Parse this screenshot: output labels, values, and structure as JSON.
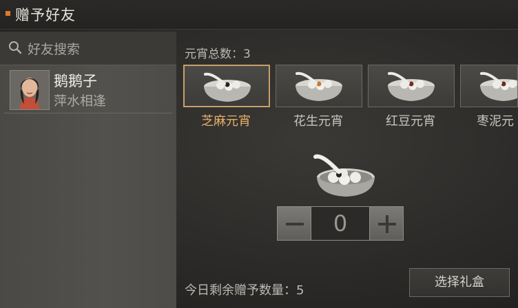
{
  "window": {
    "title": "赠予好友"
  },
  "sidebar": {
    "search_placeholder": "好友搜索",
    "friends": [
      {
        "name": "鹅鹅子",
        "signature": "萍水相逢"
      }
    ]
  },
  "main": {
    "total_label": "元宵总数：3",
    "items": [
      {
        "label": "芝麻元宵",
        "filling": "#2a2323",
        "selected": true
      },
      {
        "label": "花生元宵",
        "filling": "#c07a3a",
        "selected": false
      },
      {
        "label": "红豆元宵",
        "filling": "#7a2a2a",
        "selected": false
      },
      {
        "label": "枣泥元",
        "filling": "#6a2a22",
        "selected": false
      }
    ],
    "quantity": {
      "minus": "－",
      "value": "0",
      "plus": "＋"
    },
    "remaining_label": "今日剩余赠予数量：5",
    "giftbox_button": "选择礼盒"
  },
  "colors": {
    "accent": "#e07a2a",
    "selected_text": "#e8b06a",
    "selected_border": "#c9a06a"
  }
}
